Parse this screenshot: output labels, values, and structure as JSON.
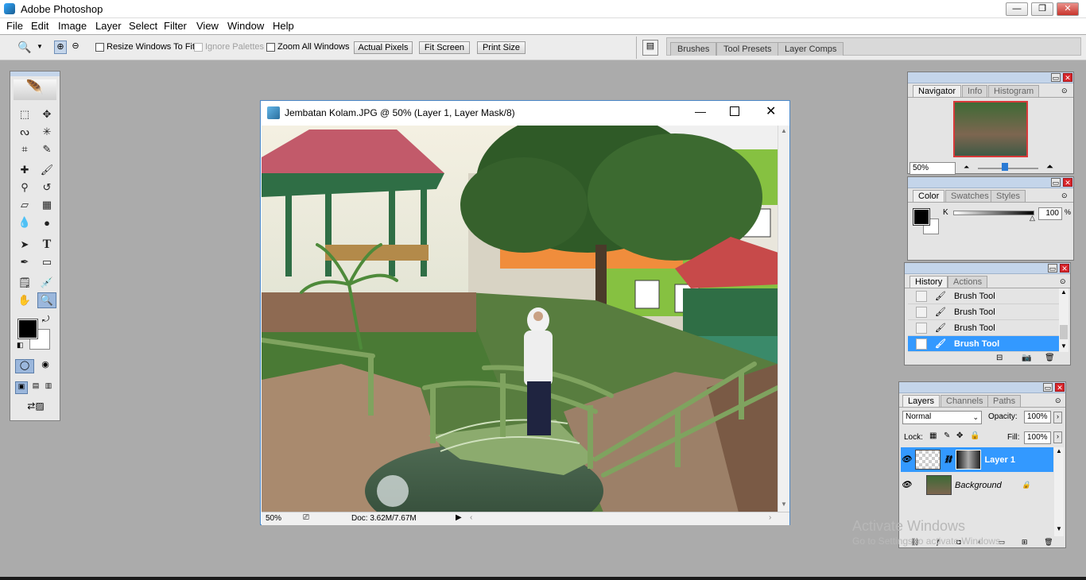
{
  "window": {
    "title": "Adobe Photoshop",
    "minimize": "—",
    "restore": "❐",
    "close": "✕"
  },
  "menu": [
    "File",
    "Edit",
    "Image",
    "Layer",
    "Select",
    "Filter",
    "View",
    "Window",
    "Help"
  ],
  "options": {
    "resize_windows": "Resize Windows To Fit",
    "ignore_palettes": "Ignore Palettes",
    "zoom_all": "Zoom All Windows",
    "actual_pixels": "Actual Pixels",
    "fit_screen": "Fit Screen",
    "print_size": "Print Size",
    "well_tabs": [
      "Brushes",
      "Tool Presets",
      "Layer Comps"
    ]
  },
  "document": {
    "title": "Jembatan Kolam.JPG @ 50% (Layer 1, Layer Mask/8)",
    "zoom": "50%",
    "doc_size": "Doc: 3.62M/7.67M"
  },
  "navigator": {
    "tabs": [
      "Navigator",
      "Info",
      "Histogram"
    ],
    "zoom": "50%"
  },
  "color": {
    "tabs": [
      "Color",
      "Swatches",
      "Styles"
    ],
    "channel": "K",
    "value": "100",
    "unit": "%",
    "foreground": "#000000",
    "background": "#ffffff"
  },
  "history": {
    "tabs": [
      "History",
      "Actions"
    ],
    "items": [
      "Brush Tool",
      "Brush Tool",
      "Brush Tool",
      "Brush Tool"
    ],
    "selected": 3
  },
  "layers": {
    "tabs": [
      "Layers",
      "Channels",
      "Paths"
    ],
    "blend_mode": "Normal",
    "opacity_label": "Opacity:",
    "opacity": "100%",
    "lock_label": "Lock:",
    "fill_label": "Fill:",
    "fill": "100%",
    "items": [
      {
        "name": "Layer 1",
        "selected": true
      },
      {
        "name": "Background",
        "selected": false
      }
    ]
  },
  "watermark": {
    "line1": "Activate Windows",
    "line2": "Go to Settings to activate Windows."
  },
  "colors": {
    "accent": "#3399ff",
    "panel_header": "#c4d5ea",
    "close_red": "#d9252b"
  }
}
